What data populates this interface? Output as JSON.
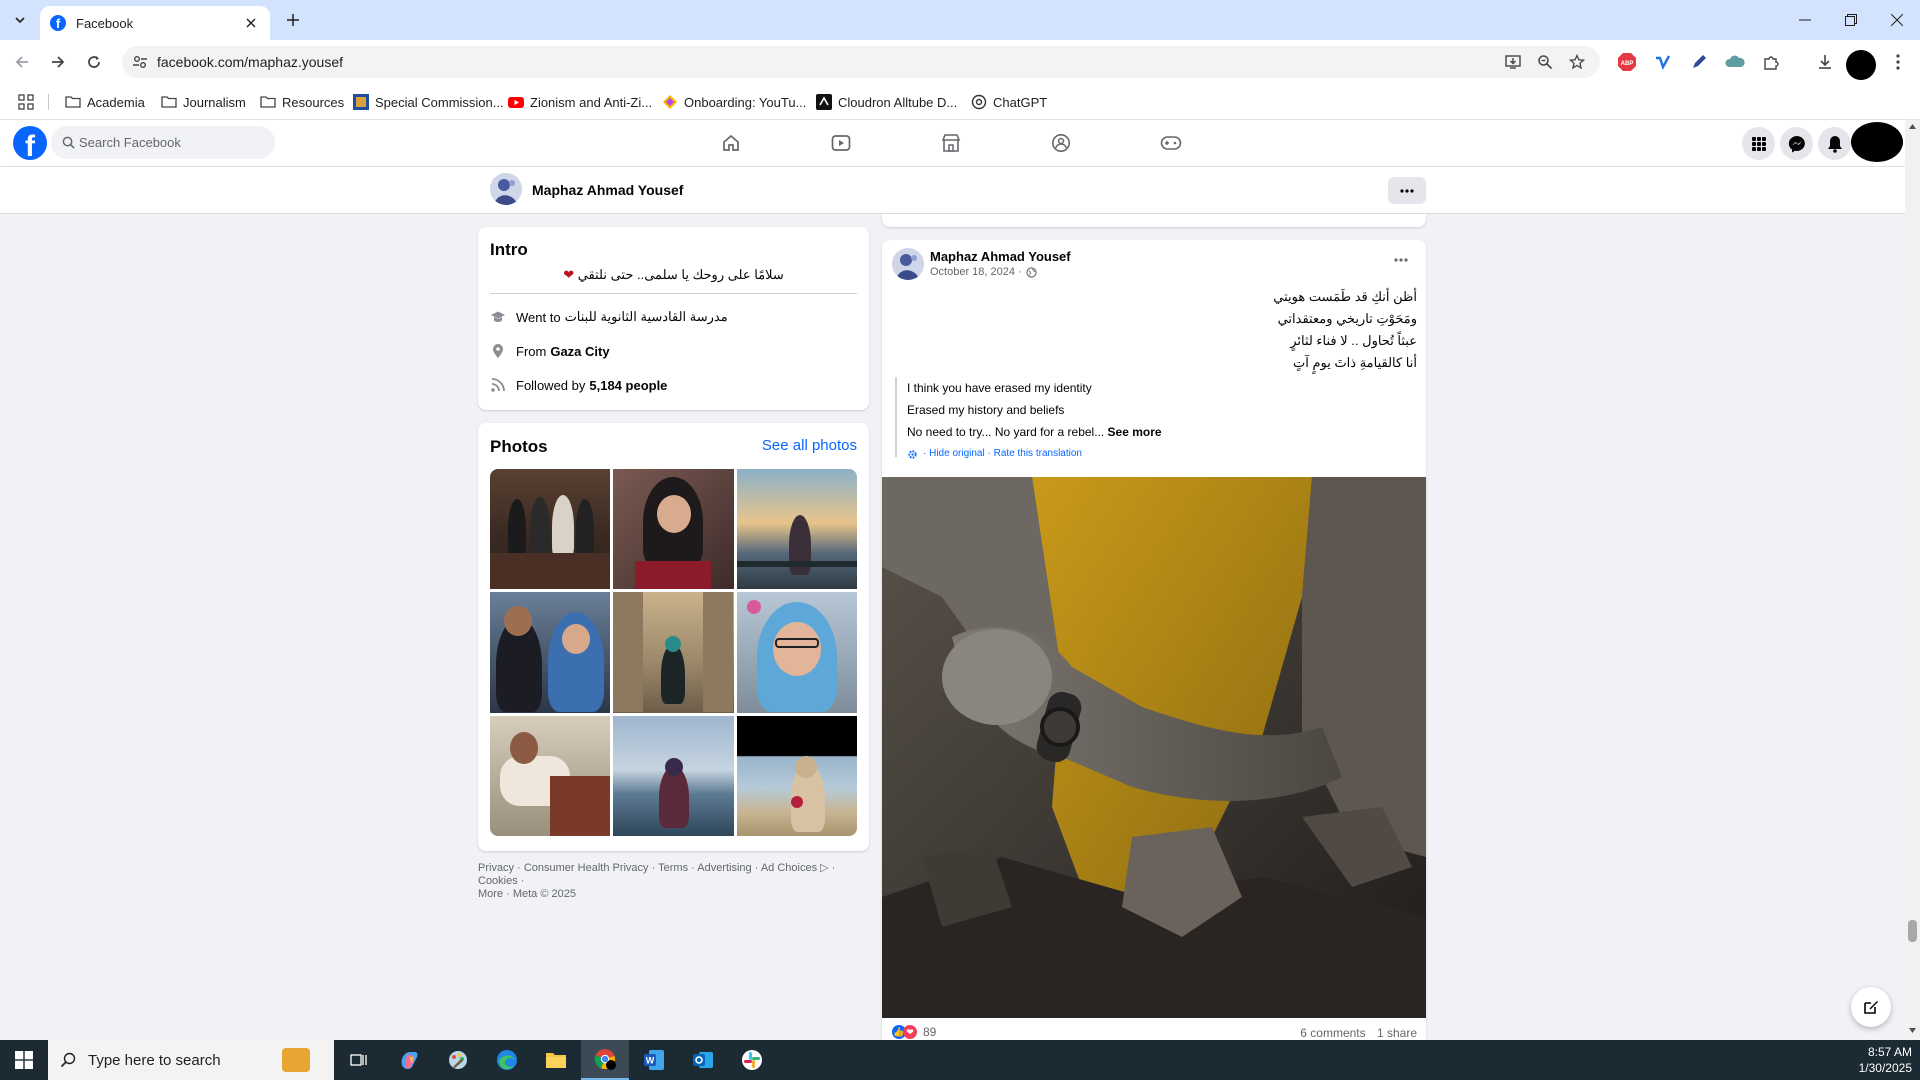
{
  "browser": {
    "tab_title": "Facebook",
    "url": "facebook.com/maphaz.yousef"
  },
  "bookmarks": [
    {
      "label": "Academia",
      "icon": "folder-icon"
    },
    {
      "label": "Journalism",
      "icon": "folder-icon"
    },
    {
      "label": "Resources",
      "icon": "folder-icon"
    },
    {
      "label": "Special Commission...",
      "icon": "site-icon"
    },
    {
      "label": "Zionism and Anti-Zi...",
      "icon": "youtube-icon"
    },
    {
      "label": "Onboarding: YouTu...",
      "icon": "site-icon"
    },
    {
      "label": "Cloudron Alltube D...",
      "icon": "site-icon"
    },
    {
      "label": "ChatGPT",
      "icon": "chatgpt-icon"
    }
  ],
  "facebook": {
    "search_placeholder": "Search Facebook"
  },
  "profile": {
    "name": "Maphaz Ahmad Yousef"
  },
  "intro": {
    "title": "Intro",
    "bio": "سلامًا على روحك يا سلمى.. حتى نلتقي",
    "education_prefix": "Went to",
    "education": "مدرسة القادسية الثانوية للبنات",
    "from_prefix": "From",
    "from": "Gaza City",
    "followed_prefix": "Followed by",
    "followed": "5,184 people"
  },
  "photos": {
    "title": "Photos",
    "see_all": "See all photos"
  },
  "footer": {
    "line1": "Privacy · Consumer Health Privacy · Terms · Advertising · Ad Choices ▷ · Cookies ·",
    "line2": "More · Meta © 2025"
  },
  "post": {
    "author": "Maphaz Ahmad Yousef",
    "date": "October 18, 2024 ·",
    "arabic_lines": [
      "أظن أنكِ قد طَمَست هويتي",
      "ومَحَوْتِ تاريخي ومعتقداتي",
      "عبثاً تُحاول .. لا فناء لثائرٍ",
      "أنا كالقيامةِ ذاتَ يومٍ آتٍ"
    ],
    "translation_lines": [
      "I think you have erased my identity",
      "Erased my history and beliefs",
      "No need to try... No yard for a rebel..."
    ],
    "see_more": "See more",
    "hide_original": "Hide original",
    "rate_translation": "Rate this translation",
    "reaction_count": "89",
    "comments": "6 comments",
    "shares": "1 share"
  },
  "taskbar": {
    "search_placeholder": "Type here to search",
    "time": "8:57 AM",
    "date": "1/30/2025"
  }
}
